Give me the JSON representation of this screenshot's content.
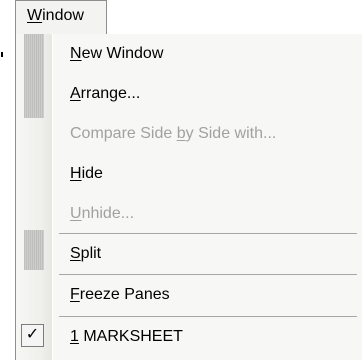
{
  "menu": {
    "title": {
      "accelerator": "W",
      "rest": "indow"
    },
    "items": [
      {
        "prefix": "",
        "accelerator": "N",
        "suffix": "ew Window",
        "enabled": true
      },
      {
        "prefix": "",
        "accelerator": "A",
        "suffix": "rrange...",
        "enabled": true
      },
      {
        "prefix": "Compare Side ",
        "accelerator": "b",
        "suffix": "y Side with...",
        "enabled": false
      },
      {
        "prefix": "",
        "accelerator": "H",
        "suffix": "ide",
        "enabled": true
      },
      {
        "prefix": "",
        "accelerator": "U",
        "suffix": "nhide...",
        "enabled": false
      },
      {
        "prefix": "",
        "accelerator": "S",
        "suffix": "plit",
        "enabled": true
      },
      {
        "prefix": "",
        "accelerator": "F",
        "suffix": "reeze Panes",
        "enabled": true
      },
      {
        "prefix": "",
        "accelerator": "1",
        "suffix": " MARKSHEET",
        "enabled": true,
        "checked": true
      }
    ],
    "check_glyph": "✓"
  },
  "colors": {
    "menu_background": "#f7f7f5",
    "disabled_text": "#a1a1a1",
    "border": "#8e8e8e"
  },
  "icons": {
    "check": "check-icon"
  }
}
